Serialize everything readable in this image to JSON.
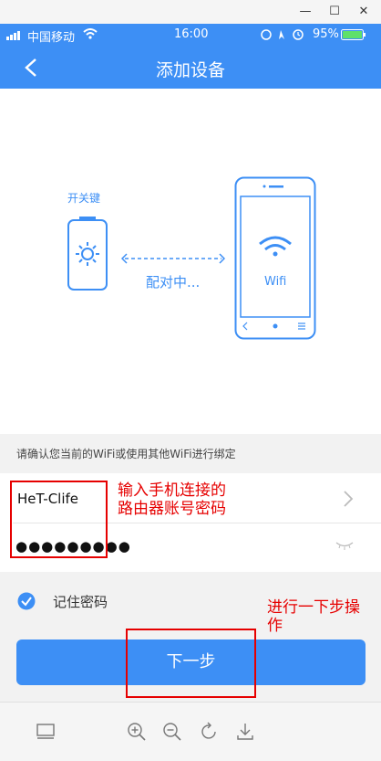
{
  "window": {
    "minimize": "—",
    "maximize": "☐",
    "close": "✕"
  },
  "status_bar": {
    "carrier": "中国移动",
    "time": "16:00",
    "battery": "95%"
  },
  "header": {
    "title": "添加设备"
  },
  "illustration": {
    "device_label": "开关键",
    "pairing_text": "配对中...",
    "phone_wifi_label": "Wifi"
  },
  "hint": "请确认您当前的WiFi或使用其他WiFi进行绑定",
  "form": {
    "ssid": "HeT-Clife",
    "password_mask": "●●●●●●●●●"
  },
  "remember": {
    "label": "记住密码",
    "checked": true
  },
  "next_button": {
    "label": "下一步"
  },
  "annotations": {
    "input_note_line1": "输入手机连接的",
    "input_note_line2": "路由器账号密码",
    "next_note_line1": "进行一下步操",
    "next_note_line2": "作"
  },
  "colors": {
    "accent": "#3d8ff5",
    "annotation": "#e60000"
  }
}
